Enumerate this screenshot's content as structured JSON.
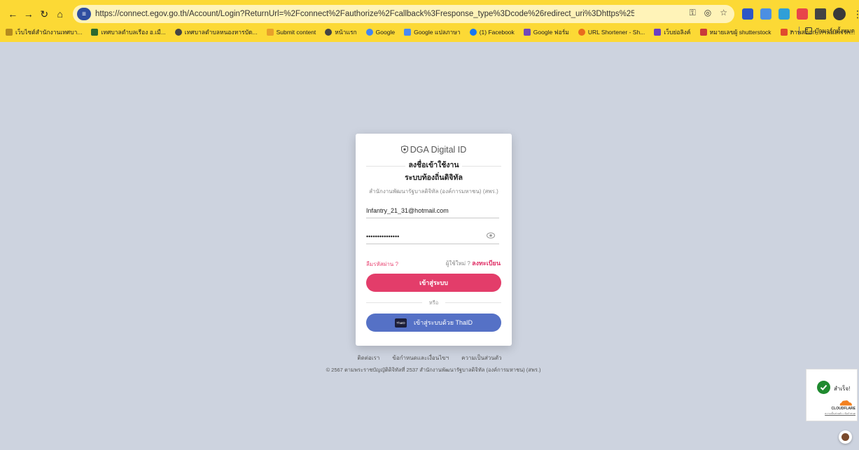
{
  "browser": {
    "url": "https://connect.egov.go.th/Account/Login?ReturnUrl=%2Fconnect%2Fauthorize%2Fcallback%3Fresponse_type%3Dcode%26redirect_uri%3Dhttps%253A%252F%252Flocalgov.egov.go.th%252Flogin-callback%26clien...",
    "bookmarks": [
      "เว็บไซต์สำนักงานเทศบา...",
      "เทศบาลตำบลเรือง อ.เมื...",
      "เทศบาลตำบลหนองหารบัด...",
      "Submit content",
      "หน้าแรก",
      "Google",
      "Google แปลภาษา",
      "(1) Facebook",
      "Google ฟอร์ม",
      "URL Shortener - Sh...",
      "เว็บย่อลิงค์",
      "หมายเลขผู้ shutterstock",
      "ภาพสต็อก, ภาพและเวก..."
    ],
    "more_bookmarks": "»",
    "all_bookmarks": "บุ๊กมาร์กทั้งหมด"
  },
  "login": {
    "brand": "DGA Digital ID",
    "title": "ลงชื่อเข้าใช้งาน",
    "subtitle": "ระบบท้องถิ่นดิจิทัล",
    "org": "สำนักงานพัฒนารัฐบาลดิจิทัล (องค์การมหาชน) (สพร.)",
    "email_value": "Infantry_21_31@hotmail.com",
    "password_value": "•••••••••••••••",
    "forgot": "ลืมรหัสผ่าน ?",
    "new_user": "ผู้ใช้ใหม่ ?",
    "register": "ลงทะเบียน",
    "login_button": "เข้าสู่ระบบ",
    "or": "หรือ",
    "thaid_button": "เข้าสู่ระบบด้วย ThaID",
    "thaid_logo": "ThaID"
  },
  "footer": {
    "links": [
      "ติดต่อเรา",
      "ข้อกำหนดและเงื่อนไขฯ",
      "ความเป็นส่วนตัว"
    ],
    "copyright": "© 2567 ตามพระราชบัญญัติดิจิทัลที่ 2537 สำนักงานพัฒนารัฐบาลดิจิทัล (องค์การมหาชน) (สพร.)"
  },
  "cloudflare": {
    "status": "สำเร็จ!",
    "brand": "CLOUDFLARE",
    "links": "ความเป็นส่วนตัว • ข้อกำหนด"
  },
  "colors": {
    "chrome": "#fcd935",
    "background": "#cdd3df",
    "login_button": "#e33d6a",
    "thaid_button": "#5571c6",
    "pink_link": "#e94a76"
  }
}
